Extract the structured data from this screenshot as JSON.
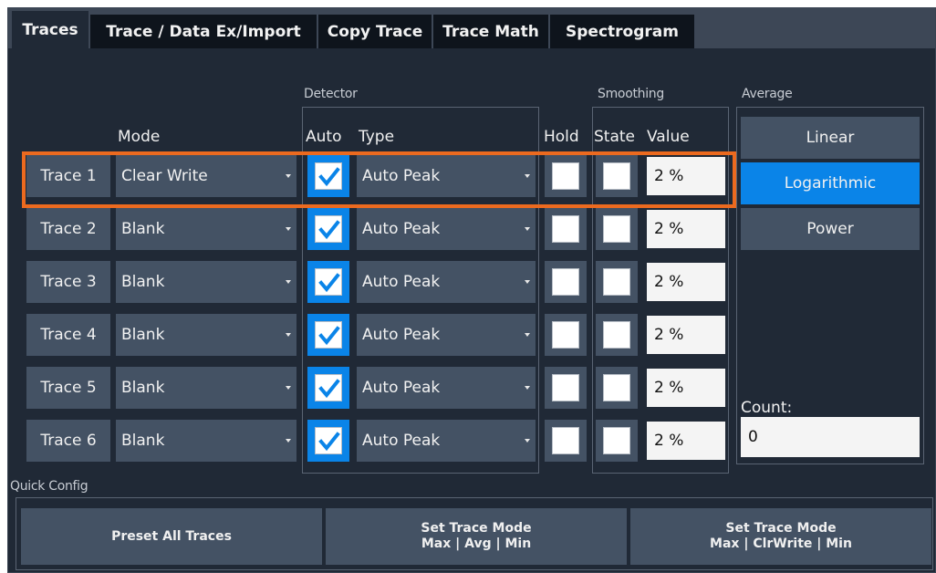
{
  "tabs": [
    {
      "label": "Traces",
      "active": true
    },
    {
      "label": "Trace / Data Ex/Import",
      "active": false
    },
    {
      "label": "Copy Trace",
      "active": false
    },
    {
      "label": "Trace Math",
      "active": false
    },
    {
      "label": "Spectrogram",
      "active": false
    }
  ],
  "groups": {
    "detector": "Detector",
    "smoothing": "Smoothing",
    "average": "Average",
    "quick_config": "Quick Config"
  },
  "columns": {
    "mode": "Mode",
    "auto": "Auto",
    "type": "Type",
    "hold": "Hold",
    "state": "State",
    "value": "Value"
  },
  "traces": [
    {
      "label": "Trace 1",
      "mode": "Clear Write",
      "auto": true,
      "type": "Auto Peak",
      "hold": false,
      "smoothing_state": false,
      "smoothing_value": "2 %",
      "selected": true
    },
    {
      "label": "Trace 2",
      "mode": "Blank",
      "auto": true,
      "type": "Auto Peak",
      "hold": false,
      "smoothing_state": false,
      "smoothing_value": "2 %",
      "selected": false
    },
    {
      "label": "Trace 3",
      "mode": "Blank",
      "auto": true,
      "type": "Auto Peak",
      "hold": false,
      "smoothing_state": false,
      "smoothing_value": "2 %",
      "selected": false
    },
    {
      "label": "Trace 4",
      "mode": "Blank",
      "auto": true,
      "type": "Auto Peak",
      "hold": false,
      "smoothing_state": false,
      "smoothing_value": "2 %",
      "selected": false
    },
    {
      "label": "Trace 5",
      "mode": "Blank",
      "auto": true,
      "type": "Auto Peak",
      "hold": false,
      "smoothing_state": false,
      "smoothing_value": "2 %",
      "selected": false
    },
    {
      "label": "Trace 6",
      "mode": "Blank",
      "auto": true,
      "type": "Auto Peak",
      "hold": false,
      "smoothing_state": false,
      "smoothing_value": "2 %",
      "selected": false
    }
  ],
  "average": {
    "options": [
      {
        "label": "Linear",
        "active": false
      },
      {
        "label": "Logarithmic",
        "active": true
      },
      {
        "label": "Power",
        "active": false
      }
    ],
    "count_label": "Count:",
    "count_value": "0"
  },
  "quick_config": {
    "preset": {
      "line1": "Preset All Traces"
    },
    "mode_avg": {
      "line1": "Set Trace Mode",
      "line2": "Max | Avg | Min"
    },
    "mode_clrwrite": {
      "line1": "Set Trace Mode",
      "line2": "Max | ClrWrite | Min"
    }
  },
  "colors": {
    "background": "#202936",
    "button": "#445264",
    "accent_blue": "#0a84e8",
    "selection_orange": "#ec6a1f",
    "field": "#f4f4f4"
  },
  "icons": {
    "checkmark": "checkmark-icon",
    "dropdown": "chevron-down-icon"
  }
}
